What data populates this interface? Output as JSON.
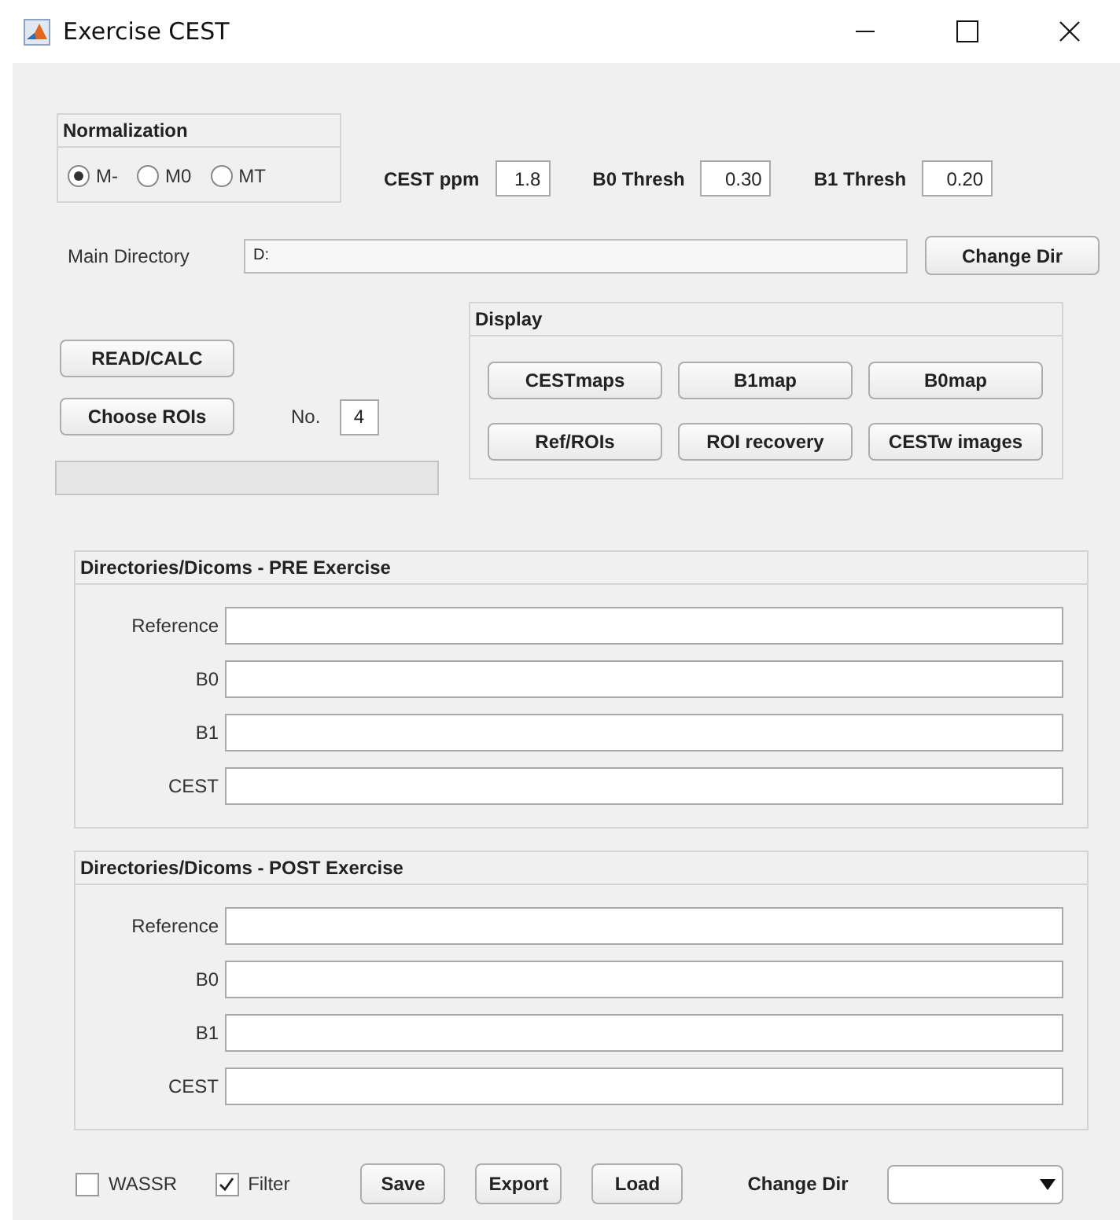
{
  "window": {
    "title": "Exercise CEST"
  },
  "normalization": {
    "title": "Normalization",
    "options": [
      {
        "label": "M-",
        "selected": true
      },
      {
        "label": "M0",
        "selected": false
      },
      {
        "label": "MT",
        "selected": false
      }
    ]
  },
  "parameters": [
    {
      "label": "CEST ppm",
      "value": "1.8"
    },
    {
      "label": "B0 Thresh",
      "value": "0.30"
    },
    {
      "label": "B1 Thresh",
      "value": "0.20"
    }
  ],
  "main_directory": {
    "label": "Main Directory",
    "value": "D:",
    "button": "Change Dir"
  },
  "actions": {
    "read_button": "READ/CALC",
    "roi_button": "Choose ROIs",
    "count_label": "No.",
    "count_value": "4"
  },
  "progress": {
    "level": 0
  },
  "display": {
    "title": "Display",
    "buttons": [
      "CESTmaps",
      "B1map",
      "B0map",
      "Ref/ROIs",
      "ROI recovery",
      "CESTw images"
    ]
  },
  "pre_exercise": {
    "title": "Directories/Dicoms - PRE Exercise",
    "rows": [
      "Reference",
      "B0",
      "B1",
      "CEST"
    ]
  },
  "post_exercise": {
    "title": "Directories/Dicoms - POST Exercise",
    "rows": [
      "Reference",
      "B0",
      "B1",
      "CEST"
    ]
  },
  "options": [
    {
      "label": "WASSR",
      "checked": false
    },
    {
      "label": "Filter",
      "checked": true
    }
  ],
  "buttons": [
    "Save",
    "Export",
    "Load"
  ],
  "change_dir": {
    "label": "Change Dir"
  }
}
